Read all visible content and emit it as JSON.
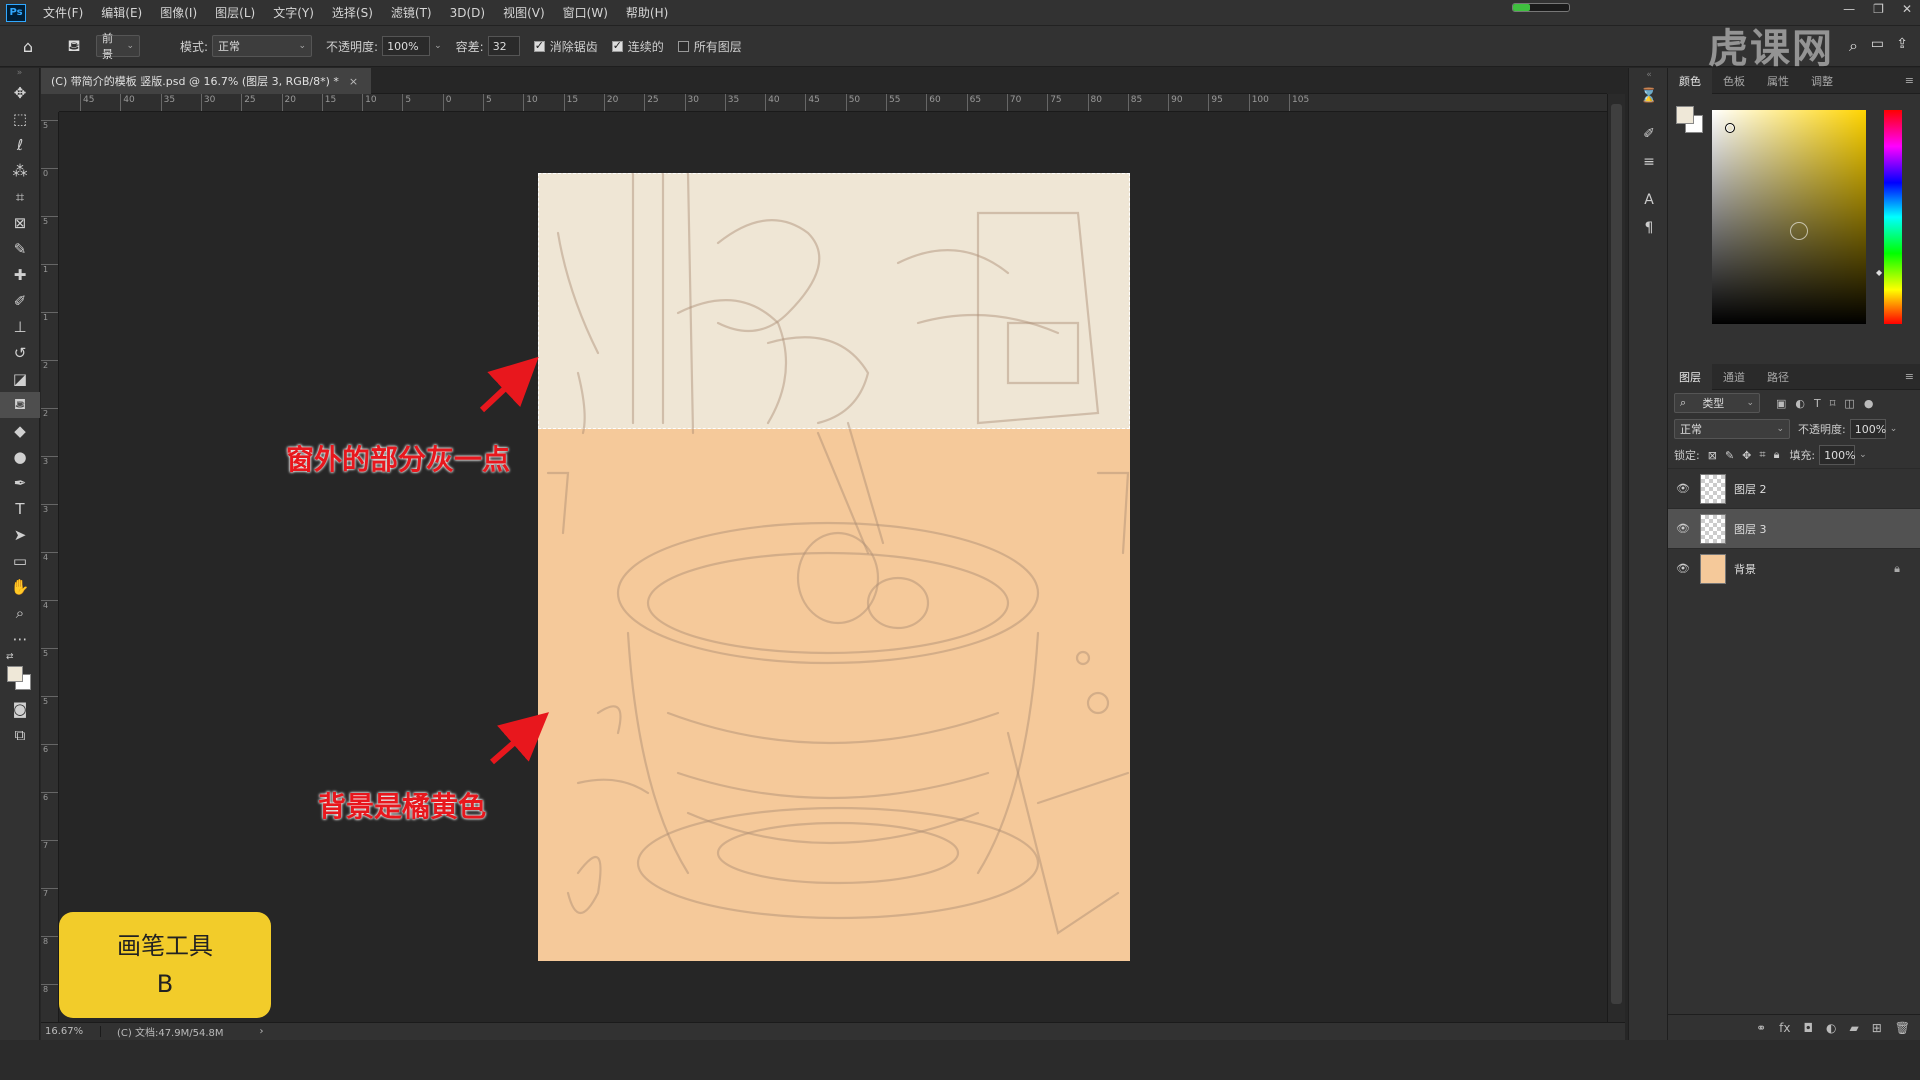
{
  "app": {
    "logo": "Ps"
  },
  "menu": [
    "文件(F)",
    "编辑(E)",
    "图像(I)",
    "图层(L)",
    "文字(Y)",
    "选择(S)",
    "滤镜(T)",
    "3D(D)",
    "视图(V)",
    "窗口(W)",
    "帮助(H)"
  ],
  "window_controls": [
    "—",
    "❐",
    "✕"
  ],
  "watermark": "虎课网",
  "progress": 0.3,
  "options": {
    "fill_source": "前景",
    "mode_label": "模式:",
    "mode_value": "正常",
    "opacity_label": "不透明度:",
    "opacity_value": "100%",
    "tolerance_label": "容差:",
    "tolerance_value": "32",
    "antialias": "消除锯齿",
    "contiguous": "连续的",
    "all_layers": "所有图层"
  },
  "document": {
    "tab_title": "(C) 带简介的模板 竖版.psd @ 16.7% (图层 3, RGB/8*) *",
    "close": "×"
  },
  "ruler": {
    "h_ticks": [
      "45",
      "40",
      "35",
      "30",
      "25",
      "20",
      "15",
      "10",
      "5",
      "0",
      "5",
      "10",
      "15",
      "20",
      "25",
      "30",
      "35",
      "40",
      "45",
      "50",
      "55",
      "60",
      "65",
      "70",
      "75",
      "80",
      "85",
      "90",
      "95",
      "100",
      "105"
    ],
    "v_ticks": [
      "5",
      "0",
      "5",
      "1",
      "1",
      "2",
      "2",
      "3",
      "3",
      "4",
      "4",
      "5",
      "5",
      "6",
      "6",
      "7",
      "7",
      "8",
      "8"
    ]
  },
  "annotations": {
    "window_note": "窗外的部分灰一点",
    "background_note": "背景是橘黄色"
  },
  "brush_badge": {
    "name": "画笔工具",
    "shortcut": "B"
  },
  "status": {
    "zoom": "16.67%",
    "doc": "(C) 文档:47.9M/54.8M",
    "arrow": "›"
  },
  "panels": {
    "color_tabs": [
      "颜色",
      "色板",
      "属性",
      "调整"
    ],
    "layers_tabs": [
      "图层",
      "通道",
      "路径"
    ],
    "filter_kind": "类型",
    "blend_mode": "正常",
    "opacity_label": "不透明度:",
    "opacity_value": "100%",
    "lock_label": "锁定:",
    "fill_label": "填充:",
    "fill_value": "100%",
    "layers": [
      {
        "name": "图层 2",
        "thumb": "transparent",
        "selected": false
      },
      {
        "name": "图层 3",
        "thumb": "transparent",
        "selected": true
      },
      {
        "name": "背景",
        "thumb": "orange",
        "selected": false,
        "locked": true
      }
    ]
  },
  "colors": {
    "background_orange": "#f5c99a",
    "window_gray": "#efe6d5",
    "annotation_red": "#e8171d",
    "badge_yellow": "#f2cc2a"
  }
}
